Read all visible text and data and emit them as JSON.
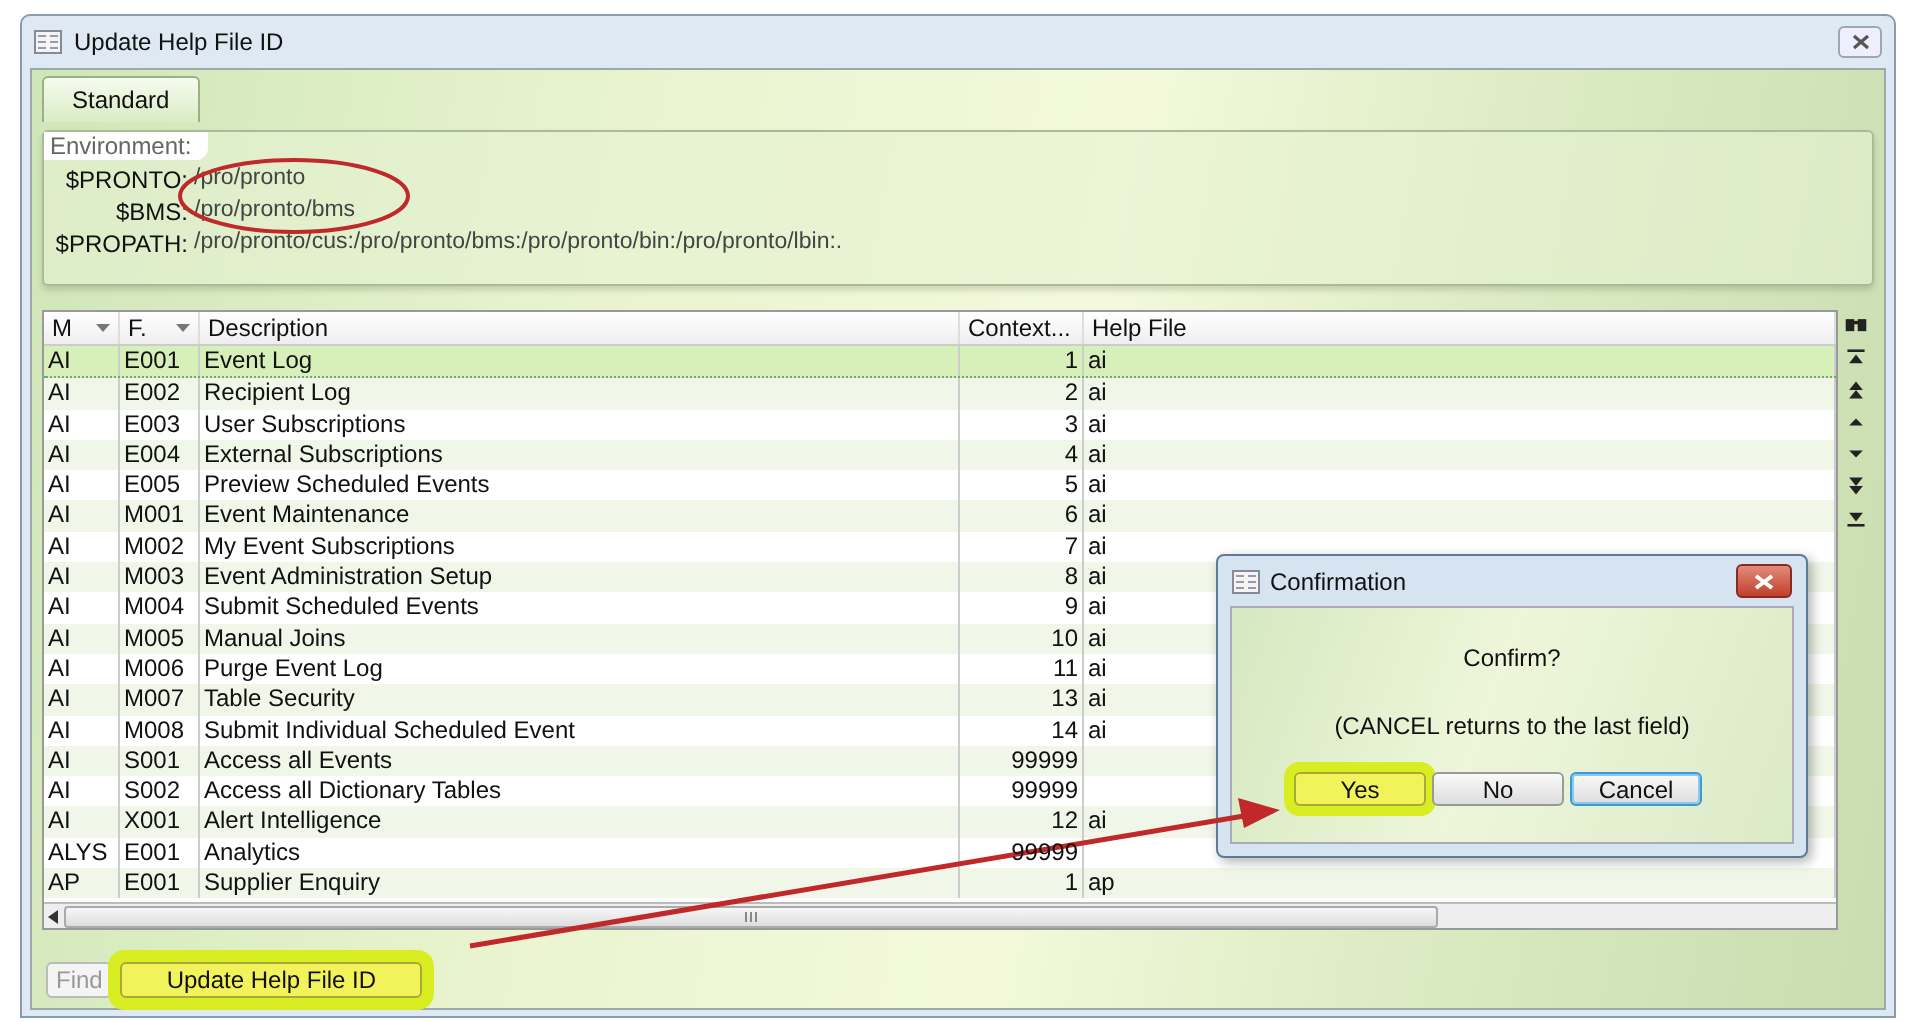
{
  "window": {
    "title": "Update Help File ID"
  },
  "tabs": [
    {
      "label": "Standard",
      "selected": true
    }
  ],
  "environment": {
    "legend": "Environment:",
    "fields": [
      {
        "label": "$PRONTO:",
        "value": "/pro/pronto"
      },
      {
        "label": "$BMS:",
        "value": "/pro/pronto/bms"
      },
      {
        "label": "$PROPATH:",
        "value": "/pro/pronto/cus:/pro/pronto/bms:/pro/pronto/bin:/pro/pronto/lbin:."
      }
    ]
  },
  "table": {
    "columns": [
      {
        "label": "M",
        "sortable": true
      },
      {
        "label": "F.",
        "sortable": true
      },
      {
        "label": "Description",
        "sortable": false
      },
      {
        "label": "Context...",
        "sortable": false
      },
      {
        "label": "Help File",
        "sortable": false
      }
    ],
    "rows": [
      {
        "cells": [
          "AI",
          "E001",
          "Event Log",
          "1",
          "ai"
        ],
        "selected": true
      },
      {
        "cells": [
          "AI",
          "E002",
          "Recipient Log",
          "2",
          "ai"
        ],
        "selected": false
      },
      {
        "cells": [
          "AI",
          "E003",
          "User Subscriptions",
          "3",
          "ai"
        ],
        "selected": false
      },
      {
        "cells": [
          "AI",
          "E004",
          "External Subscriptions",
          "4",
          "ai"
        ],
        "selected": false
      },
      {
        "cells": [
          "AI",
          "E005",
          "Preview Scheduled Events",
          "5",
          "ai"
        ],
        "selected": false
      },
      {
        "cells": [
          "AI",
          "M001",
          "Event Maintenance",
          "6",
          "ai"
        ],
        "selected": false
      },
      {
        "cells": [
          "AI",
          "M002",
          "My Event Subscriptions",
          "7",
          "ai"
        ],
        "selected": false
      },
      {
        "cells": [
          "AI",
          "M003",
          "Event Administration Setup",
          "8",
          "ai"
        ],
        "selected": false
      },
      {
        "cells": [
          "AI",
          "M004",
          "Submit Scheduled Events",
          "9",
          "ai"
        ],
        "selected": false
      },
      {
        "cells": [
          "AI",
          "M005",
          "Manual Joins",
          "10",
          "ai"
        ],
        "selected": false
      },
      {
        "cells": [
          "AI",
          "M006",
          "Purge Event Log",
          "11",
          "ai"
        ],
        "selected": false
      },
      {
        "cells": [
          "AI",
          "M007",
          "Table Security",
          "13",
          "ai"
        ],
        "selected": false
      },
      {
        "cells": [
          "AI",
          "M008",
          "Submit Individual Scheduled Event",
          "14",
          "ai"
        ],
        "selected": false
      },
      {
        "cells": [
          "AI",
          "S001",
          "Access all Events",
          "99999",
          ""
        ],
        "selected": false
      },
      {
        "cells": [
          "AI",
          "S002",
          "Access all Dictionary Tables",
          "99999",
          ""
        ],
        "selected": false
      },
      {
        "cells": [
          "AI",
          "X001",
          "Alert Intelligence",
          "12",
          "ai"
        ],
        "selected": false
      },
      {
        "cells": [
          "ALYS",
          "E001",
          "Analytics",
          "99999",
          ""
        ],
        "selected": false
      },
      {
        "cells": [
          "AP",
          "E001",
          "Supplier Enquiry",
          "1",
          "ap"
        ],
        "selected": false
      }
    ]
  },
  "footer_buttons": [
    {
      "label": "Find",
      "disabled": true,
      "highlighted": false
    },
    {
      "label": "Update Help File ID",
      "disabled": false,
      "highlighted": true
    }
  ],
  "dialog": {
    "title": "Confirmation",
    "message": "Confirm?",
    "note": "(CANCEL returns to the last field)",
    "buttons": [
      {
        "label": "Yes",
        "highlighted": true,
        "focused": false
      },
      {
        "label": "No",
        "highlighted": false,
        "focused": false
      },
      {
        "label": "Cancel",
        "highlighted": false,
        "focused": true
      }
    ]
  }
}
